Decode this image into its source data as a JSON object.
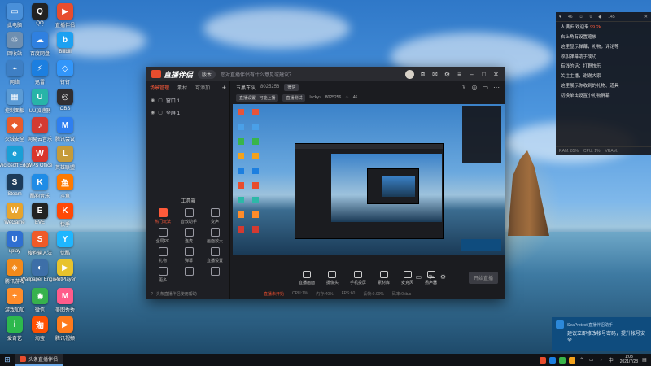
{
  "desktop": {
    "icons": [
      {
        "label": "此电脑",
        "color": "#4a90d9",
        "glyph": "▭"
      },
      {
        "label": "回收站",
        "color": "#6f8fb0",
        "glyph": "♲"
      },
      {
        "label": "网络",
        "color": "#3e7fc4",
        "glyph": "⌁"
      },
      {
        "label": "控制面板",
        "color": "#5b9bd5",
        "glyph": "▦"
      },
      {
        "label": "火绒安全",
        "color": "#e85b2c",
        "glyph": "◆"
      },
      {
        "label": "Microsoft Edge",
        "color": "#1a9fd6",
        "glyph": "e"
      },
      {
        "label": "Steam",
        "color": "#1c3b5a",
        "glyph": "S"
      },
      {
        "label": "WeGame",
        "color": "#e8a42c",
        "glyph": "W"
      },
      {
        "label": "uplay",
        "color": "#2f6fd1",
        "glyph": "U"
      },
      {
        "label": "腾讯游戏",
        "color": "#f28a1b",
        "glyph": "◈"
      },
      {
        "label": "游戏加加",
        "color": "#ff8c2a",
        "glyph": "+"
      },
      {
        "label": "爱奇艺",
        "color": "#2db84d",
        "glyph": "i"
      },
      {
        "label": "QQ",
        "color": "#222",
        "glyph": "Q"
      },
      {
        "label": "百度网盘",
        "color": "#2f80e0",
        "glyph": "☁"
      },
      {
        "label": "迅雷",
        "color": "#1c7fe0",
        "glyph": "⚡"
      },
      {
        "label": "UU加速器",
        "color": "#28b4a8",
        "glyph": "U"
      },
      {
        "label": "网易云音乐",
        "color": "#d33a31",
        "glyph": "♪"
      },
      {
        "label": "WPS Office",
        "color": "#d9352c",
        "glyph": "W"
      },
      {
        "label": "酷狗音乐",
        "color": "#1f8ce6",
        "glyph": "K"
      },
      {
        "label": "EVE",
        "color": "#222",
        "glyph": "E"
      },
      {
        "label": "搜狗输入法",
        "color": "#f05a28",
        "glyph": "S"
      },
      {
        "label": "Wallpaper Engine",
        "color": "#3d6fa8",
        "glyph": "◐"
      },
      {
        "label": "微信",
        "color": "#37b24d",
        "glyph": "◉"
      },
      {
        "label": "淘宝",
        "color": "#ff5000",
        "glyph": "淘"
      },
      {
        "label": "直播伴侣",
        "color": "#e84d2e",
        "glyph": "▶"
      },
      {
        "label": "Bilibili",
        "color": "#1da1f2",
        "glyph": "b"
      },
      {
        "label": "钉钉",
        "color": "#3296fa",
        "glyph": "◇"
      },
      {
        "label": "OBS",
        "color": "#302e31",
        "glyph": "◎"
      },
      {
        "label": "腾讯会议",
        "color": "#2f7ff0",
        "glyph": "M"
      },
      {
        "label": "英雄联盟",
        "color": "#c69b3a",
        "glyph": "L"
      },
      {
        "label": "斗鱼",
        "color": "#ff7a00",
        "glyph": "鱼"
      },
      {
        "label": "快手",
        "color": "#ff4906",
        "glyph": "K"
      },
      {
        "label": "优酷",
        "color": "#1fb6ff",
        "glyph": "Y"
      },
      {
        "label": "PotPlayer",
        "color": "#e8c32c",
        "glyph": "▶"
      },
      {
        "label": "美图秀秀",
        "color": "#ff5b8a",
        "glyph": "M"
      },
      {
        "label": "腾讯视频",
        "color": "#ff7a1a",
        "glyph": "▶"
      }
    ]
  },
  "app": {
    "brand": "直播伴侣",
    "version": "版本",
    "hint": "您对直播伴侣有什么意见或建议？",
    "side_tabs": [
      "场景管理",
      "素材",
      "可添加"
    ],
    "side_add": "+",
    "scenes": [
      "窗口 1",
      "全屏 1"
    ],
    "tools_title": "工具箱",
    "tools": [
      {
        "label": "热门玩法",
        "hot": true
      },
      {
        "label": "音效助手",
        "hot": false
      },
      {
        "label": "变声",
        "hot": false
      },
      {
        "label": "全局PK",
        "hot": false
      },
      {
        "label": "连麦",
        "hot": false
      },
      {
        "label": "画面放大",
        "hot": false
      },
      {
        "label": "礼物",
        "hot": false
      },
      {
        "label": "弹幕",
        "hot": false
      },
      {
        "label": "直播设置",
        "hot": false
      },
      {
        "label": "更多",
        "hot": false
      },
      {
        "label": "",
        "hot": false
      },
      {
        "label": "",
        "hot": false
      }
    ],
    "side_footer": "头条直播伴侣使用帮助",
    "room": {
      "name": "五黑车队",
      "id": "8025256",
      "tag": "微信",
      "sub_pill_1": "直播设置 · 可能上播",
      "sub_pill_2": "直播测试",
      "viewer_label": "lucky~",
      "count": "8025256",
      "likes": "46"
    },
    "controls": [
      "直播画面",
      "摄像头",
      "手机投屏",
      "素材库",
      "麦克风",
      "扬声器"
    ],
    "start_label": "开始直播",
    "status": {
      "warn": "直播未开始",
      "items": [
        "CPU:1%",
        "内存:40%",
        "FPS:60",
        "丢帧:0.00%",
        "码率:0kb/s"
      ]
    }
  },
  "chat": {
    "top": [
      "46",
      "0",
      "145"
    ],
    "lines": [
      {
        "user": "人满步",
        "text": "欢迎来",
        "hl": "99.2k"
      },
      {
        "user": "",
        "text": "右上角有设置缩放",
        "hl": ""
      },
      {
        "user": "",
        "text": "这里显示弹幕，礼物，评论等",
        "hl": ""
      },
      {
        "user": "",
        "text": "添加弹幕助手成功",
        "hl": ""
      },
      {
        "user": "",
        "text": "有钱的话：打野快乐",
        "hl": ""
      },
      {
        "user": "",
        "text": "关注主播，谢谢大家",
        "hl": ""
      },
      {
        "user": "",
        "text": "这里展示你收到的礼物、道具",
        "hl": ""
      },
      {
        "user": "",
        "text": "切换单击设置小礼物屏幕",
        "hl": ""
      }
    ],
    "bottom": [
      "RAM: 85%",
      "CPU: 1%",
      "VRAM:"
    ]
  },
  "notification": {
    "app": "SeaProtect 直播伴侣助手",
    "body": "建议立即修改帐号密码，提升帐号安全"
  },
  "taskbar": {
    "app_label": "头条直播伴侣",
    "time": "1:03",
    "date": "2021/7/28"
  }
}
